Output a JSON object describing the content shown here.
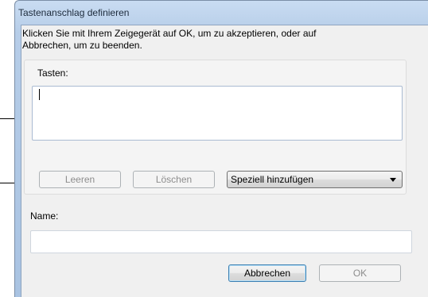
{
  "window": {
    "title": "Tastenanschlag definieren"
  },
  "instructions": {
    "line1": "Klicken Sie mit Ihrem Zeigegerät auf OK, um zu akzeptieren, oder auf",
    "line2": "Abbrechen, um zu beenden."
  },
  "keys": {
    "label": "Tasten:",
    "value": ""
  },
  "buttons": {
    "clear": "Leeren",
    "delete": "Löschen",
    "cancel": "Abbrechen",
    "ok": "OK"
  },
  "special_add": {
    "selected": "Speziell hinzufügen"
  },
  "name": {
    "label": "Name:",
    "value": ""
  },
  "colors": {
    "window_frame": "#b6cde8",
    "client_bg": "#f0f0f0",
    "disabled_text": "#8d8d8d"
  }
}
